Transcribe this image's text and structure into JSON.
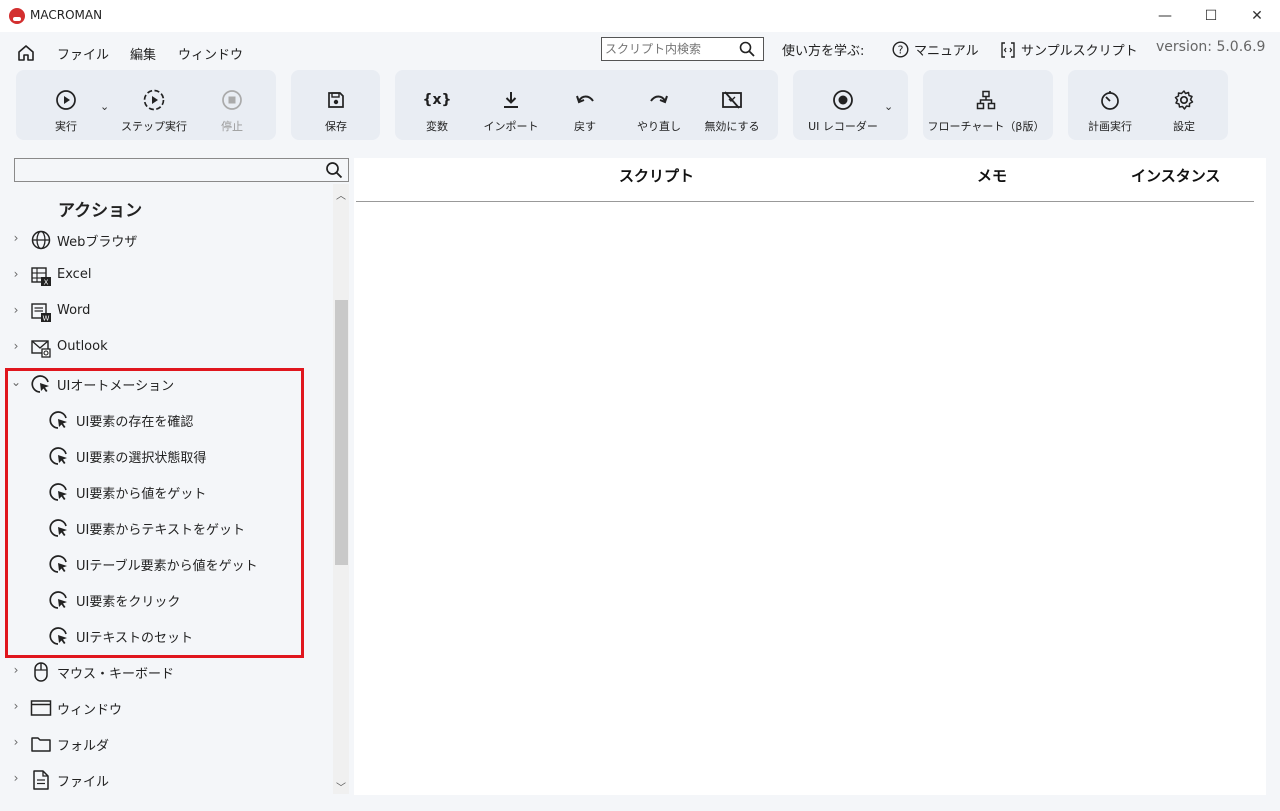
{
  "window": {
    "title": "MACROMAN",
    "minimize": "—",
    "maximize": "☐",
    "close": "✕"
  },
  "menu": {
    "items": [
      "ファイル",
      "編集",
      "ウィンドウ"
    ]
  },
  "header": {
    "search_placeholder": "スクリプト内検索",
    "learn": "使い方を学ぶ:",
    "manual": "マニュアル",
    "samples": "サンプルスクリプト",
    "version": "version: 5.0.6.9"
  },
  "toolbar": {
    "run": "実行",
    "step_run": "ステップ実行",
    "stop": "停止",
    "save": "保存",
    "variables": "変数",
    "import": "インポート",
    "undo": "戻す",
    "redo": "やり直し",
    "disable": "無効にする",
    "ui_recorder": "UI レコーダー",
    "flowchart": "フローチャート（β版）",
    "scheduled_run": "計画実行",
    "settings": "設定",
    "variables_icon_text": "{x}"
  },
  "sidebar": {
    "title": "アクション",
    "search_value": "",
    "categories": [
      {
        "label": "Webブラウザ",
        "icon": "globe-icon"
      },
      {
        "label": "Excel",
        "icon": "excel-icon"
      },
      {
        "label": "Word",
        "icon": "word-icon"
      },
      {
        "label": "Outlook",
        "icon": "outlook-icon"
      },
      {
        "label": "UIオートメーション",
        "icon": "cursor-click-icon",
        "expanded": true
      },
      {
        "label": "マウス・キーボード",
        "icon": "mouse-icon"
      },
      {
        "label": "ウィンドウ",
        "icon": "window-icon"
      },
      {
        "label": "フォルダ",
        "icon": "folder-icon"
      },
      {
        "label": "ファイル",
        "icon": "file-icon"
      }
    ],
    "ui_automation_items": [
      "UI要素の存在を確認",
      "UI要素の選択状態取得",
      "UI要素から値をゲット",
      "UI要素からテキストをゲット",
      "UIテーブル要素から値をゲット",
      "UI要素をクリック",
      "UIテキストのセット"
    ]
  },
  "main": {
    "columns": [
      "スクリプト",
      "メモ",
      "インスタンス"
    ]
  },
  "colors": {
    "highlight": "#e0161e",
    "toolbar_group": "#e9edf3",
    "background": "#f4f6f9"
  }
}
